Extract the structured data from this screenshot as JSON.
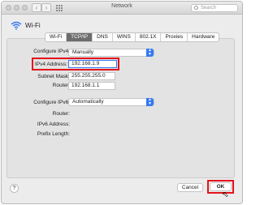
{
  "window": {
    "title": "Network",
    "search_placeholder": "Search"
  },
  "header": {
    "title": "Wi-Fi",
    "icon": "wifi-icon"
  },
  "tabs": [
    {
      "label": "Wi-Fi",
      "active": false
    },
    {
      "label": "TCP/IP",
      "active": true
    },
    {
      "label": "DNS",
      "active": false
    },
    {
      "label": "WINS",
      "active": false
    },
    {
      "label": "802.1X",
      "active": false
    },
    {
      "label": "Proxies",
      "active": false
    },
    {
      "label": "Hardware",
      "active": false
    }
  ],
  "ipv4": {
    "configure_label": "Configure IPv4:",
    "configure_value": "Manually",
    "address_label": "IPv4 Address:",
    "address_value": "192.168.1.9",
    "subnet_label": "Subnet Mask:",
    "subnet_value": "255.255.255.0",
    "router_label": "Router:",
    "router_value": "192.168.1.1"
  },
  "ipv6": {
    "configure_label": "Configure IPv6:",
    "configure_value": "Automatically",
    "router_label": "Router:",
    "address_label": "IPv6 Address:",
    "prefix_label": "Prefix Length:"
  },
  "footer": {
    "help_label": "?",
    "cancel_label": "Cancel",
    "ok_label": "OK"
  },
  "colors": {
    "accent": "#3478f6",
    "highlight": "#e3131b",
    "active_tab": "#6d6d6d"
  }
}
